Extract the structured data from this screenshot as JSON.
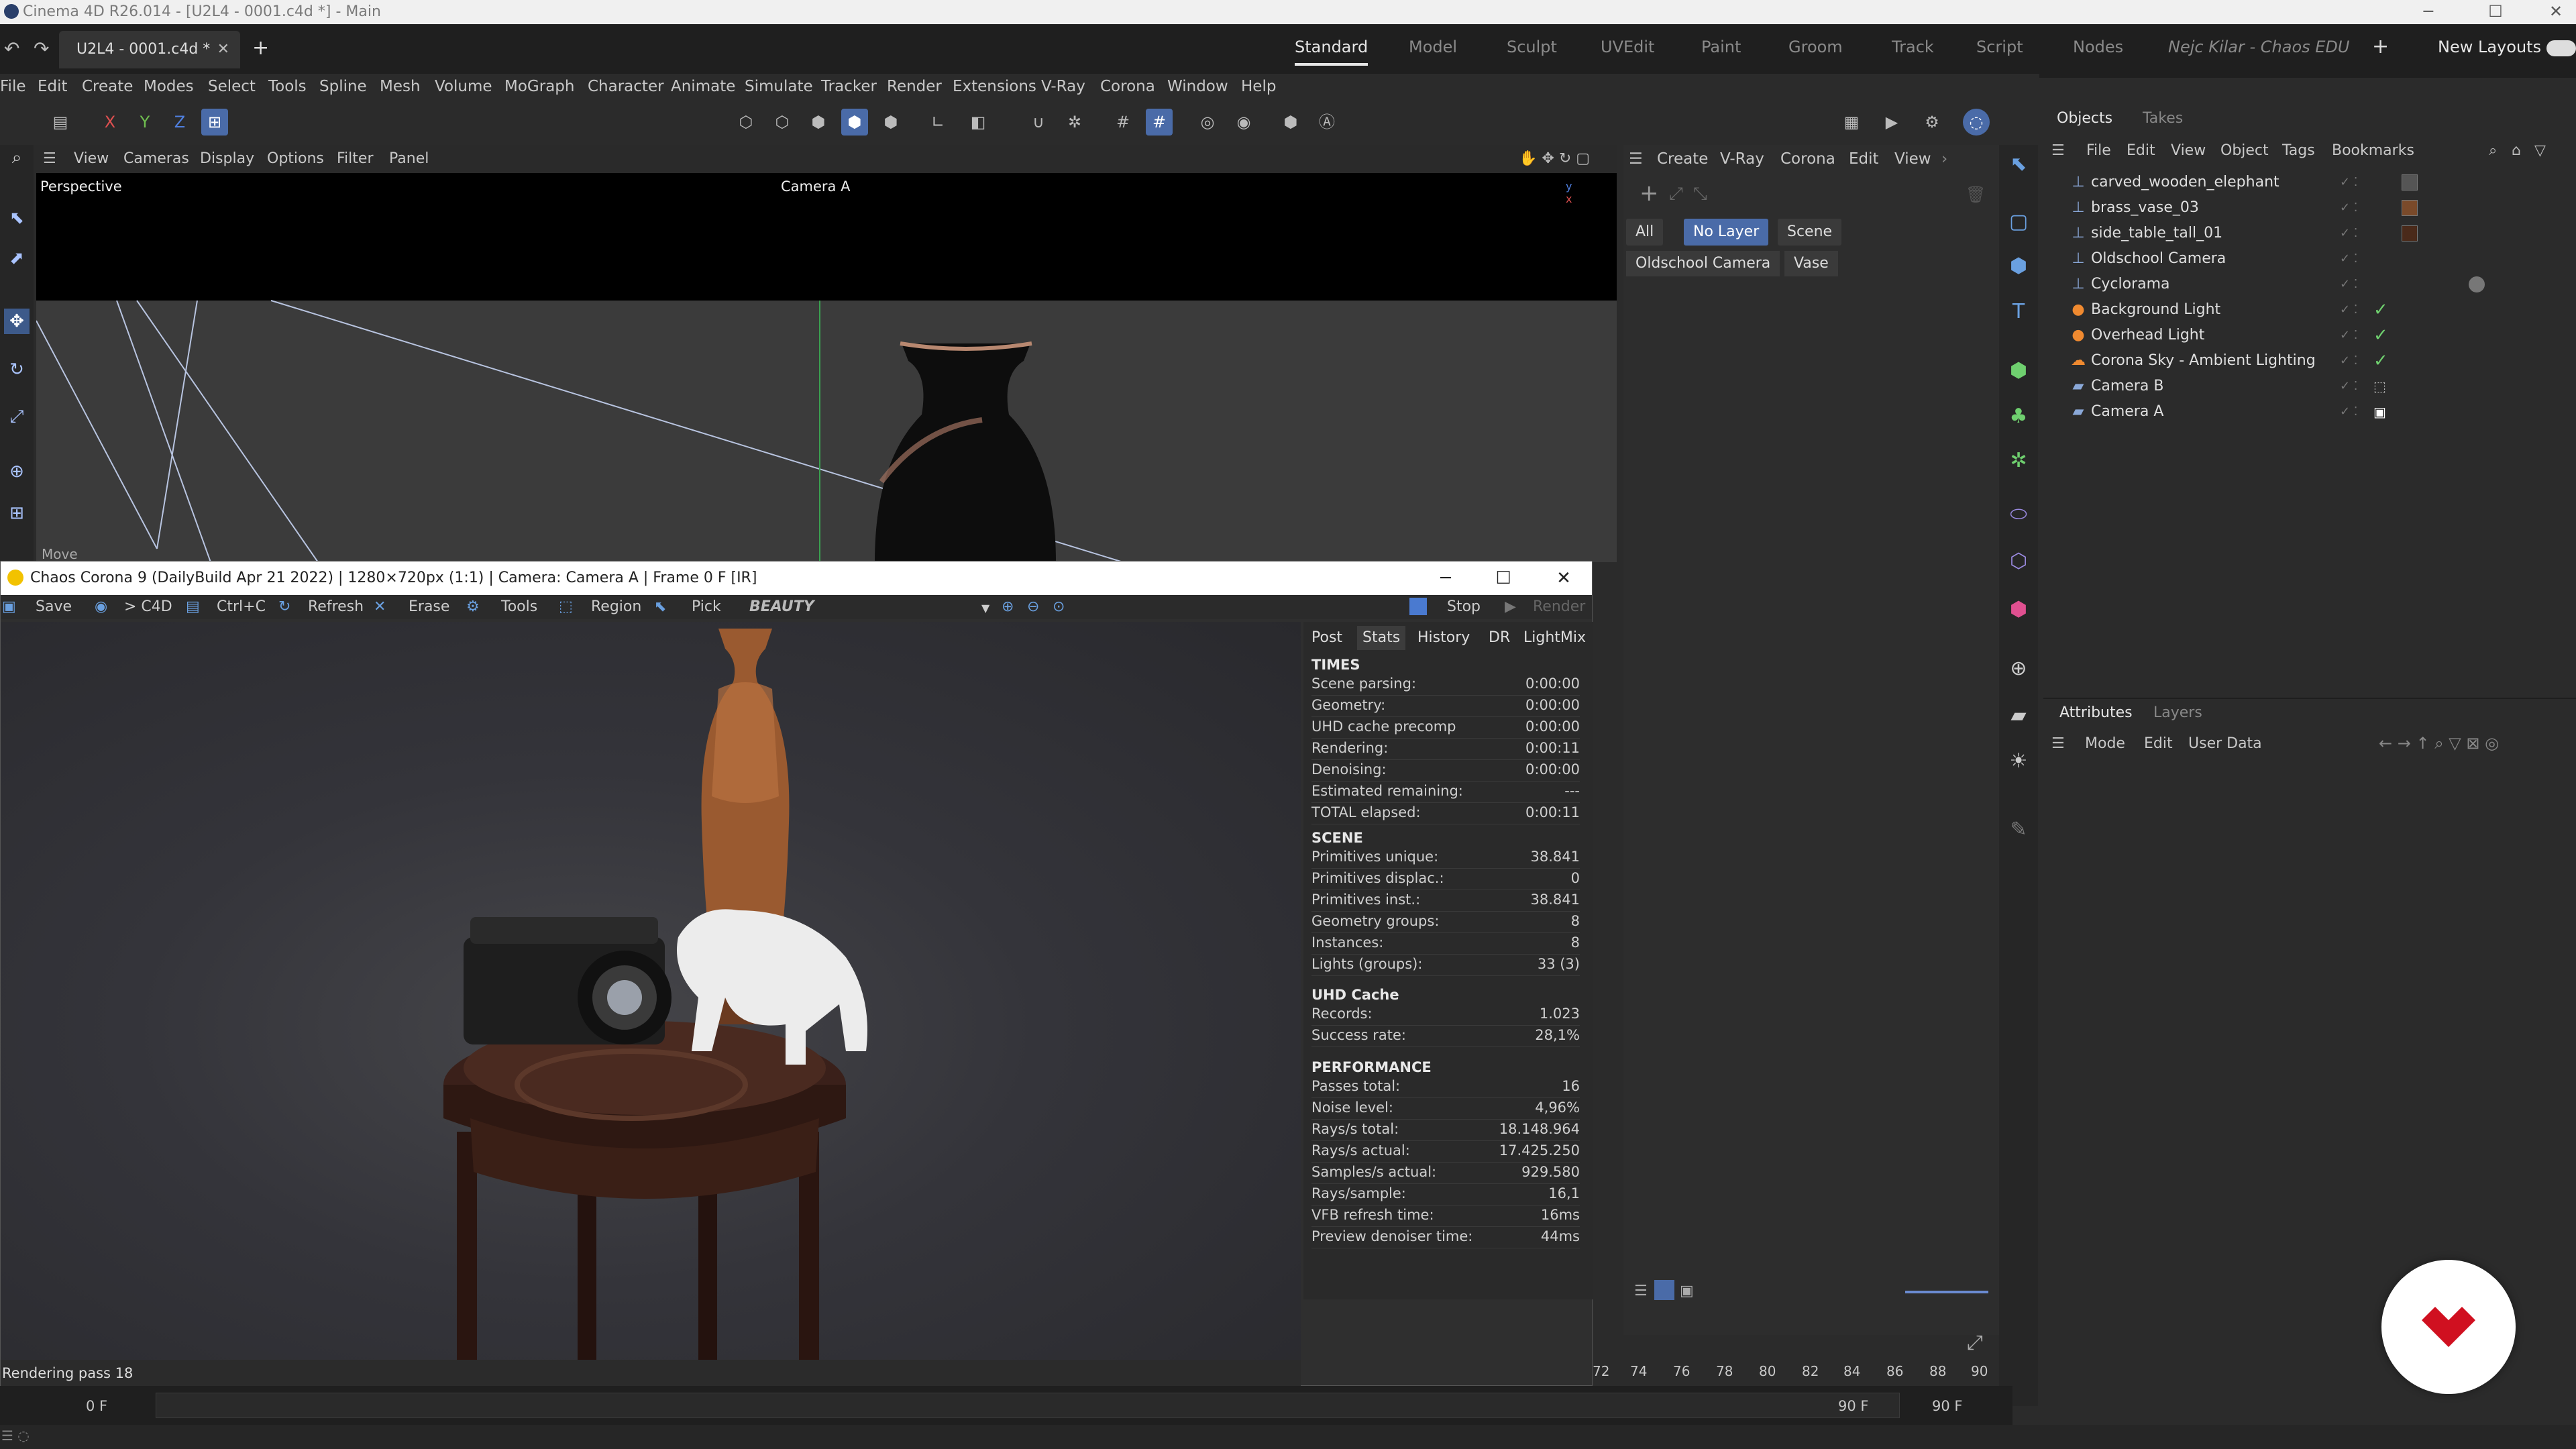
{
  "window": {
    "title": "Cinema 4D R26.014 - [U2L4 - 0001.c4d *] - Main"
  },
  "tabs": {
    "doc": "U2L4 - 0001.c4d *",
    "new": "+"
  },
  "layouts": {
    "items": [
      "Standard",
      "Model",
      "Sculpt",
      "UVEdit",
      "Paint",
      "Groom",
      "Track",
      "Script",
      "Nodes"
    ],
    "user": "Nejc Kilar - Chaos EDU",
    "new_layouts": "New Layouts"
  },
  "menus": [
    "File",
    "Edit",
    "Create",
    "Modes",
    "Select",
    "Tools",
    "Spline",
    "Mesh",
    "Volume",
    "MoGraph",
    "Character",
    "Animate",
    "Simulate",
    "Tracker",
    "Render",
    "Extensions",
    "V-Ray",
    "Corona",
    "Window",
    "Help"
  ],
  "axes": {
    "x": "X",
    "y": "Y",
    "z": "Z"
  },
  "viewport": {
    "menu": [
      "View",
      "Cameras",
      "Display",
      "Options",
      "Filter",
      "Panel"
    ],
    "label": "Perspective",
    "camera": "Camera A",
    "move_label": "Move"
  },
  "render_window": {
    "title": "Chaos Corona 9 (DailyBuild Apr 21 2022) | 1280×720px (1:1) | Camera: Camera A | Frame 0 F [IR]",
    "tools": [
      "Save",
      "> C4D",
      "Ctrl+C",
      "Refresh",
      "Erase",
      "Tools",
      "Region",
      "Pick"
    ],
    "pass": "BEAUTY",
    "stop": "Stop",
    "render": "Render",
    "status": "Rendering pass 18",
    "stat_tabs": [
      "Post",
      "Stats",
      "History",
      "DR",
      "LightMix"
    ],
    "sections": {
      "times": "TIMES",
      "scene": "SCENE",
      "uhd": "UHD Cache",
      "performance": "PERFORMANCE"
    },
    "times": [
      {
        "k": "Scene parsing:",
        "v": "0:00:00"
      },
      {
        "k": "Geometry:",
        "v": "0:00:00"
      },
      {
        "k": "UHD cache precomp",
        "v": "0:00:00"
      },
      {
        "k": "Rendering:",
        "v": "0:00:11"
      },
      {
        "k": "Denoising:",
        "v": "0:00:00"
      },
      {
        "k": "Estimated remaining:",
        "v": "---"
      },
      {
        "k": "TOTAL elapsed:",
        "v": "0:00:11"
      }
    ],
    "scene": [
      {
        "k": "Primitives unique:",
        "v": "38.841"
      },
      {
        "k": "Primitives displac.:",
        "v": "0"
      },
      {
        "k": "Primitives inst.:",
        "v": "38.841"
      },
      {
        "k": "Geometry groups:",
        "v": "8"
      },
      {
        "k": "Instances:",
        "v": "8"
      },
      {
        "k": "Lights (groups):",
        "v": "33 (3)"
      }
    ],
    "uhd": [
      {
        "k": "Records:",
        "v": "1.023"
      },
      {
        "k": "Success rate:",
        "v": "28,1%"
      }
    ],
    "performance": [
      {
        "k": "Passes total:",
        "v": "16"
      },
      {
        "k": "Noise level:",
        "v": "4,96%"
      },
      {
        "k": "Rays/s total:",
        "v": "18.148.964"
      },
      {
        "k": "Rays/s actual:",
        "v": "17.425.250"
      },
      {
        "k": "Samples/s actual:",
        "v": "929.580"
      },
      {
        "k": "Rays/sample:",
        "v": "16,1"
      },
      {
        "k": "VFB refresh time:",
        "v": "16ms"
      },
      {
        "k": "Preview denoiser time:",
        "v": "44ms"
      }
    ]
  },
  "layer_panel": {
    "menu": [
      "Create",
      "V-Ray",
      "Corona",
      "Edit",
      "View"
    ],
    "filters": [
      "All",
      "No Layer",
      "Scene"
    ],
    "chips": [
      "Oldschool Camera",
      "Vase"
    ]
  },
  "objects_panel": {
    "tabs": [
      "Objects",
      "Takes"
    ],
    "menu": [
      "File",
      "Edit",
      "View",
      "Object",
      "Tags",
      "Bookmarks"
    ],
    "items": [
      {
        "name": "carved_wooden_elephant",
        "icon": "null-icon"
      },
      {
        "name": "brass_vase_03",
        "icon": "null-icon"
      },
      {
        "name": "side_table_tall_01",
        "icon": "null-icon"
      },
      {
        "name": "Oldschool Camera",
        "icon": "null-icon"
      },
      {
        "name": "Cyclorama",
        "icon": "null-icon"
      },
      {
        "name": "Background Light",
        "icon": "light-icon"
      },
      {
        "name": "Overhead Light",
        "icon": "light-icon"
      },
      {
        "name": "Corona Sky - Ambient Lighting",
        "icon": "sky-icon"
      },
      {
        "name": "Camera B",
        "icon": "camera-icon"
      },
      {
        "name": "Camera A",
        "icon": "camera-icon"
      }
    ]
  },
  "attributes_panel": {
    "tabs": [
      "Attributes",
      "Layers"
    ],
    "menu": [
      "Mode",
      "Edit",
      "User Data"
    ]
  },
  "timeline": {
    "ticks": [
      "72",
      "74",
      "76",
      "78",
      "80",
      "82",
      "84",
      "86",
      "88",
      "90"
    ],
    "start": "0 F",
    "current": "0 F",
    "end1": "90 F",
    "end2": "90 F"
  }
}
